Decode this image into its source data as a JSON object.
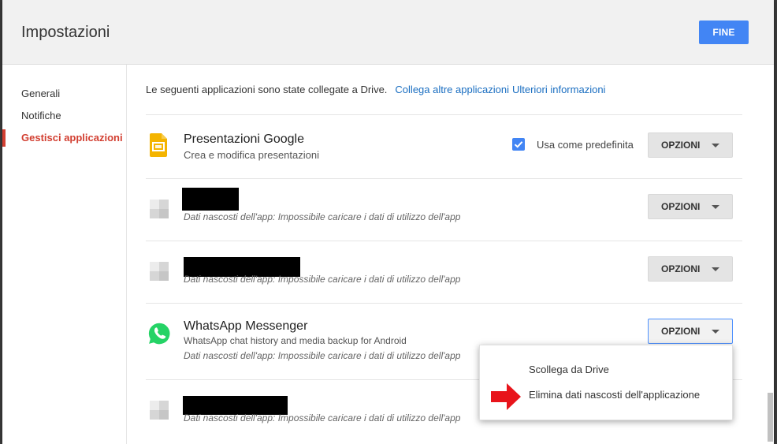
{
  "header": {
    "title": "Impostazioni",
    "done_label": "FINE"
  },
  "sidebar": {
    "items": [
      {
        "label": "Generali"
      },
      {
        "label": "Notifiche"
      },
      {
        "label": "Gestisci applicazioni"
      }
    ]
  },
  "intro": {
    "text": "Le seguenti applicazioni sono state collegate a Drive.",
    "link_connect": "Collega altre applicazioni",
    "link_info": "Ulteriori informazioni"
  },
  "apps": [
    {
      "name": "Presentazioni Google",
      "description": "Crea e modifica presentazioni",
      "default_label": "Usa come predefinita",
      "default_checked": true,
      "options_label": "OPZIONI",
      "icon": "google-slides-icon",
      "icon_color": "#f4b400"
    },
    {
      "note": "Dati nascosti dell'app: Impossibile caricare i dati di utilizzo dell'app",
      "options_label": "OPZIONI",
      "icon": "placeholder-app-icon"
    },
    {
      "note": "Dati nascosti dell'app: Impossibile caricare i dati di utilizzo dell'app",
      "options_label": "OPZIONI",
      "icon": "placeholder-app-icon"
    },
    {
      "name": "WhatsApp Messenger",
      "description": "WhatsApp chat history and media backup for Android",
      "note": "Dati nascosti dell'app: Impossibile caricare i dati di utilizzo dell'app",
      "options_label": "OPZIONI",
      "icon": "whatsapp-icon",
      "icon_color": "#25d366"
    },
    {
      "note": "Dati nascosti dell'app: Impossibile caricare i dati di utilizzo dell'app",
      "icon": "placeholder-app-icon"
    }
  ],
  "menu": {
    "items": [
      {
        "label": "Scollega da Drive"
      },
      {
        "label": "Elimina dati nascosti dell'applicazione"
      }
    ],
    "arrow_color": "#e8141b"
  },
  "colors": {
    "accent": "#4285f4",
    "active_nav": "#d23f31",
    "link": "#1a6ec1"
  }
}
